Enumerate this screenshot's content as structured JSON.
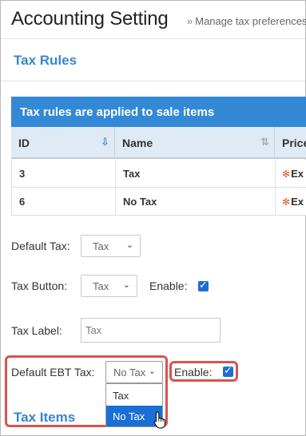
{
  "header": {
    "title": "Accounting Setting",
    "subtitle_prefix": "»",
    "subtitle": "Manage tax preferences"
  },
  "tax_rules": {
    "section_title": "Tax Rules",
    "table_caption": "Tax rules are applied to sale items",
    "columns": [
      "ID",
      "Name",
      "Price"
    ],
    "rows": [
      {
        "id": "3",
        "name": "Tax",
        "price": "Ex"
      },
      {
        "id": "6",
        "name": "No Tax",
        "price": "Ex"
      }
    ]
  },
  "form": {
    "default_tax_label": "Default Tax:",
    "default_tax_value": "Tax",
    "tax_button_label": "Tax Button:",
    "tax_button_value": "Tax",
    "tax_button_enable_label": "Enable:",
    "tax_label_label": "Tax Label:",
    "tax_label_placeholder": "Tax",
    "default_ebt_tax_label": "Default EBT Tax:",
    "default_ebt_tax_value": "No Tax",
    "ebt_enable_label": "Enable:",
    "ebt_options": [
      "Tax",
      "No Tax"
    ]
  },
  "tax_items": {
    "section_title": "Tax Items"
  },
  "colors": {
    "accent": "#3389d5",
    "highlight": "#d9534f",
    "selected": "#1a6fd5"
  }
}
